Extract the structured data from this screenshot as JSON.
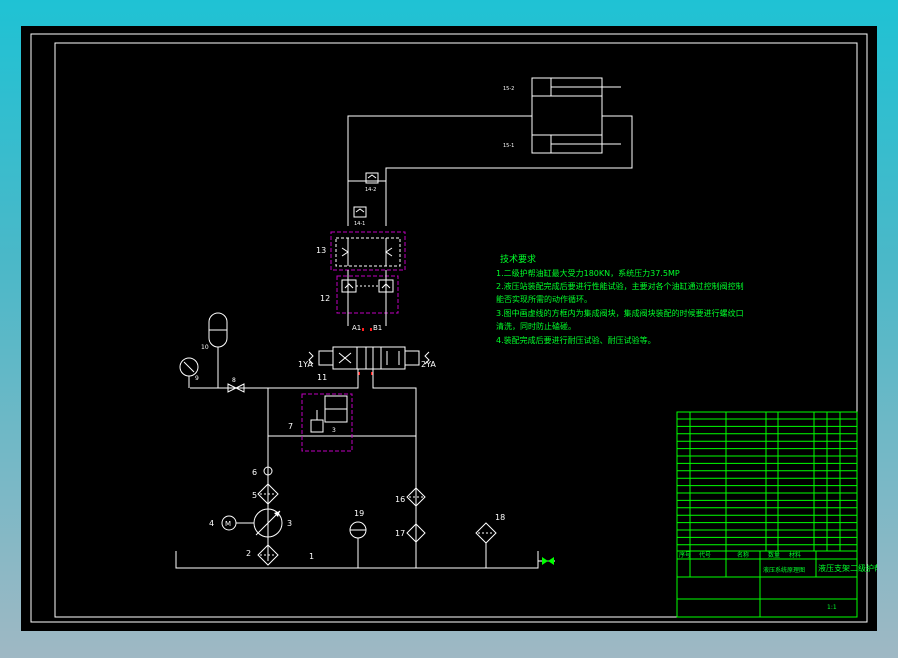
{
  "colors": {
    "background": "#000000",
    "line": "#ffffff",
    "notes": "#00ff2a",
    "block_frame": "#c000c0",
    "red_marker": "#ff2020",
    "screen_border": "#1fc2d4"
  },
  "labels": {
    "cyl_top": "15-2",
    "cyl_bottom": "15-1",
    "check_top": "14-2",
    "check_bottom": "14-1",
    "block_13": "13",
    "block_12": "12",
    "port_a": "A1",
    "port_b": "B1",
    "coil_left": "1YA",
    "coil_right": "2YA",
    "valve_11": "11",
    "accumulator": "10",
    "gauge": "9",
    "ball_valve": "8",
    "relief_block": "7",
    "relief_inner": "3",
    "item_6": "6",
    "item_5": "5",
    "motor_num": "4",
    "motor_letter": "M",
    "pump": "3",
    "filter_2": "2",
    "tank": "1",
    "item_19": "19",
    "item_16": "16",
    "item_17": "17",
    "item_18": "18"
  },
  "notes": {
    "heading": "技术要求",
    "line1": "1.二级护帮油缸最大受力180KN，系统压力37.5MP",
    "line2a": "2.液压站装配完成后要进行性能试验，主要对各个油缸通过控制阀控制",
    "line2b": "能否实现所需的动作循环。",
    "line3a": "3.图中画虚线的方框内为集成阀块，集成阀块装配的时候要进行螺纹口",
    "line3b": "清洗，同时防止磕碰。",
    "line4": "4.装配完成后要进行耐压试验、耐压试验等。"
  },
  "title_block": {
    "drawing_title": "液压支架二级护帮",
    "subtitle": "液压系统原理图",
    "header_seq": "序号",
    "header_code": "代号",
    "header_name": "名称",
    "header_qty": "数量",
    "header_material": "材料",
    "scale": "1:1"
  }
}
